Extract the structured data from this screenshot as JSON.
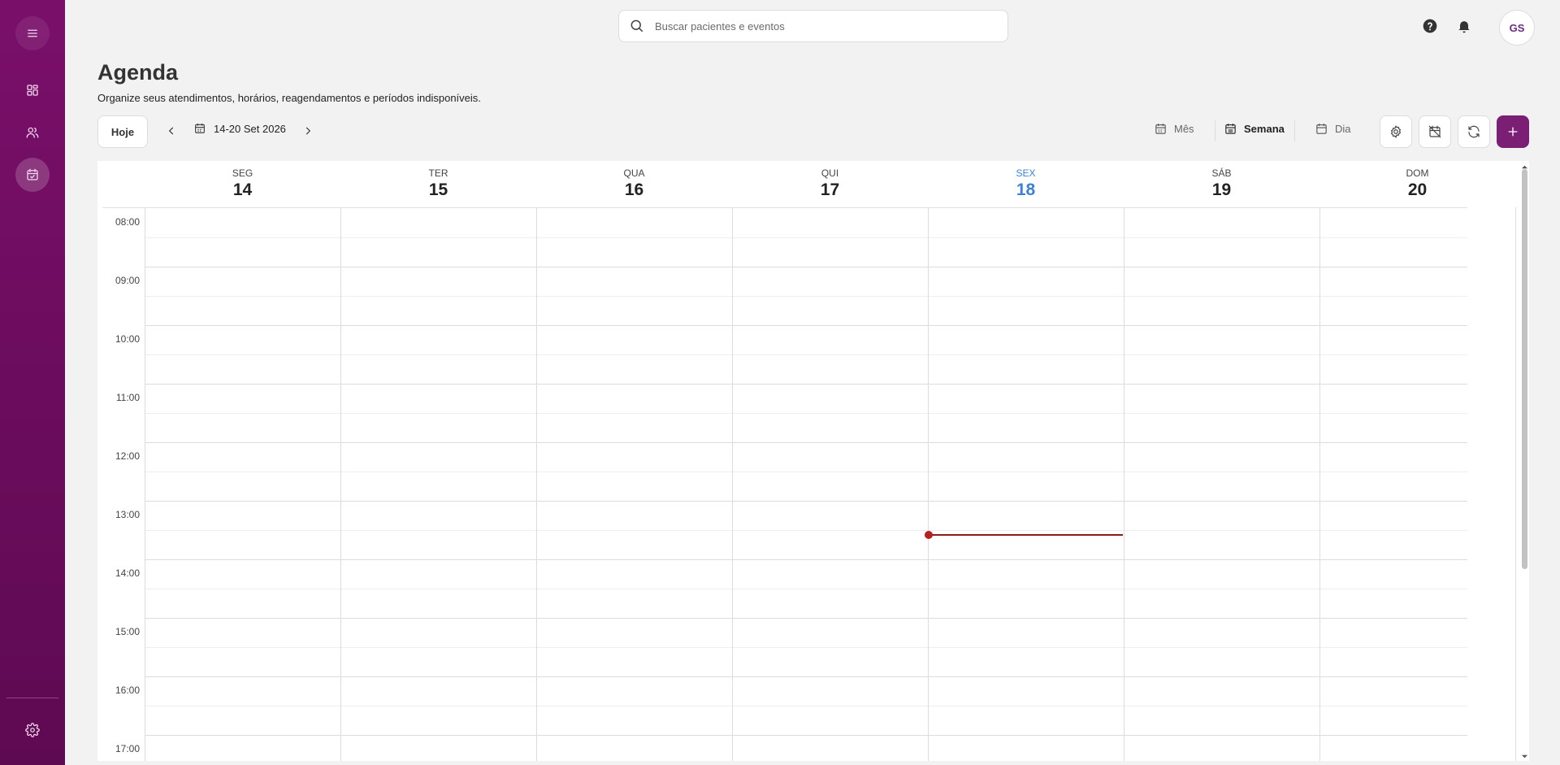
{
  "sidebar": {
    "items": [
      {
        "name": "menu"
      },
      {
        "name": "dashboard"
      },
      {
        "name": "patients"
      },
      {
        "name": "calendar",
        "active": true
      },
      {
        "name": "settings"
      }
    ]
  },
  "search": {
    "placeholder": "Buscar pacientes e eventos"
  },
  "user": {
    "initials": "GS"
  },
  "header": {
    "title": "Agenda",
    "subtitle": "Organize seus atendimentos, horários, reagendamentos e períodos indisponíveis."
  },
  "toolbar": {
    "today_label": "Hoje",
    "range_label": "14-20 Set 2026",
    "views": {
      "month": "Mês",
      "week": "Semana",
      "day": "Dia"
    },
    "active_view": "Semana"
  },
  "calendar": {
    "days": [
      {
        "name": "SEG",
        "date": "14"
      },
      {
        "name": "TER",
        "date": "15"
      },
      {
        "name": "QUA",
        "date": "16"
      },
      {
        "name": "QUI",
        "date": "17"
      },
      {
        "name": "SEX",
        "date": "18",
        "today": true
      },
      {
        "name": "SÁB",
        "date": "19"
      },
      {
        "name": "DOM",
        "date": "20"
      }
    ],
    "hours": [
      "08:00",
      "09:00",
      "10:00",
      "11:00",
      "12:00",
      "13:00",
      "14:00",
      "15:00",
      "16:00",
      "17:00"
    ],
    "current_time_indicator": {
      "day": "SEX"
    }
  },
  "colors": {
    "sidebar": "#7a0f6a",
    "accent": "#7a1f74",
    "today": "#3b82d6",
    "now_line": "#8b1a1a"
  }
}
